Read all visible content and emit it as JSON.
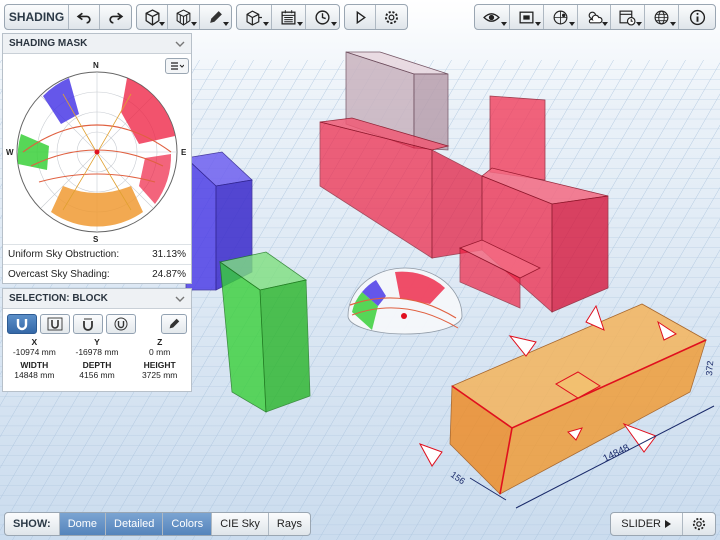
{
  "toolbar": {
    "mode_label": "SHADING",
    "icons": [
      "undo-icon",
      "redo-icon",
      "cube-icon",
      "cube-grid-icon",
      "pencil-icon",
      "cube-arrow-icon",
      "calendar-icon",
      "clock-icon",
      "play-icon",
      "gear-icon",
      "eye-icon",
      "frame-icon",
      "sun-path-icon",
      "sun-cloud-icon",
      "calendar-clock-icon",
      "globe-icon",
      "info-icon"
    ]
  },
  "shading_mask": {
    "title": "SHADING MASK",
    "menu_icon": "list-icon",
    "compass": {
      "north": "N",
      "south": "S",
      "east": "E",
      "west": "W"
    },
    "uniform_label": "Uniform Sky Obstruction:",
    "uniform_value": "31.13%",
    "overcast_label": "Overcast Sky Shading:",
    "overcast_value": "24.87%"
  },
  "selection": {
    "title": "SELECTION: BLOCK",
    "x_label": "X",
    "x_value": "-10974 mm",
    "y_label": "Y",
    "y_value": "-16978 mm",
    "z_label": "Z",
    "z_value": "0 mm",
    "width_label": "WIDTH",
    "width_value": "14848 mm",
    "depth_label": "DEPTH",
    "depth_value": "4156 mm",
    "height_label": "HEIGHT",
    "height_value": "3725 mm"
  },
  "scene": {
    "dim_width": "14848",
    "dim_depth": "156",
    "dim_height": "372",
    "colors": {
      "red": "#ee2244",
      "blue": "#4a3ae6",
      "green": "#39d039",
      "orange": "#f09a32",
      "grey": "#c9b3bf",
      "sky": "#d8e6f3"
    }
  },
  "bottom": {
    "show_label": "SHOW:",
    "buttons": [
      "Dome",
      "Detailed",
      "Colors",
      "CIE Sky",
      "Rays"
    ],
    "slider_label": "SLIDER"
  }
}
